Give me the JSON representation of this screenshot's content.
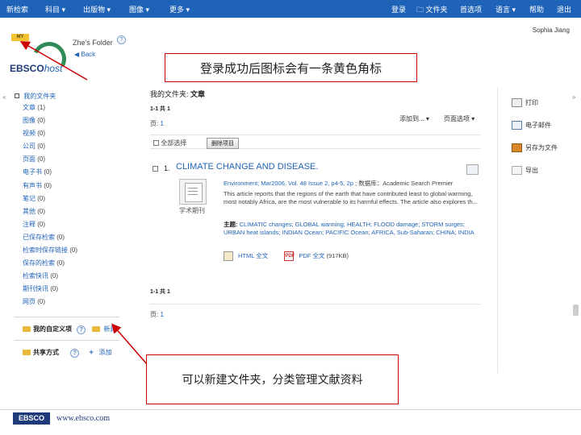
{
  "topnav": {
    "items": [
      "新检索",
      "科目 ▾",
      "出版物 ▾",
      "图像 ▾",
      "更多 ▾",
      "登录",
      "文件夹",
      "首选项",
      "语言 ▾",
      "帮助",
      "退出"
    ]
  },
  "user": {
    "name": "Sophia Jiang"
  },
  "header": {
    "badge": "MY",
    "folder_title": "Zhe's Folder",
    "back": "◀ Back",
    "help": "?",
    "logo_main": "EBSCO",
    "logo_host": "host"
  },
  "callouts": {
    "top": "登录成功后图标会有一条黄色角标",
    "bottom": "可以新建文件夹，分类管理文献资料"
  },
  "sidebar": {
    "collapse_left": "«",
    "collapse_right": "»",
    "heading": "我的文件夹",
    "folders": [
      {
        "label": "文章",
        "count": "(1)"
      },
      {
        "label": "图像",
        "count": "(0)"
      },
      {
        "label": "视频",
        "count": "(0)"
      },
      {
        "label": "公司",
        "count": "(0)"
      },
      {
        "label": "页面",
        "count": "(0)"
      },
      {
        "label": "电子书",
        "count": "(0)"
      },
      {
        "label": "有声书",
        "count": "(0)"
      },
      {
        "label": "笔记",
        "count": "(0)"
      },
      {
        "label": "其他",
        "count": "(0)"
      },
      {
        "label": "注释",
        "count": "(0)"
      },
      {
        "label": "已保存检索",
        "count": "(0)"
      },
      {
        "label": "检索时保存链接",
        "count": "(0)"
      },
      {
        "label": "保存的检索",
        "count": "(0)"
      },
      {
        "label": "检索快讯",
        "count": "(0)"
      },
      {
        "label": "期刊快讯",
        "count": "(0)"
      },
      {
        "label": "网页",
        "count": "(0)"
      }
    ],
    "custom_section": "我的自定义项",
    "custom_new": "新建",
    "shared_section": "共享方式",
    "shared_add": "添加"
  },
  "main": {
    "title_prefix": "我的文件夹:",
    "title_value": "文章",
    "range_top": "1-1 共 1",
    "page_label": "页:",
    "page_num": "1",
    "add_to": "添加到... ▾",
    "page_options": "页面选项 ▾",
    "select_all": "全部选择",
    "delete_items": "删除项目",
    "range_bottom": "1-1 共 1",
    "page_label_bottom": "页:",
    "page_num_bottom": "1"
  },
  "result": {
    "number": "1.",
    "title": "CLIMATE CHANGE AND DISEASE.",
    "meta_source": "Environment; Mar2006, Vol. 48 Issue 2, p4-5, 2p",
    "meta_db": " ; 数据库：Academic Search Premier",
    "doc_label": "学术期刊",
    "abstract": "This article reports that the regions of the earth that have contributed least to global warming, most notably Africa, are the most vulnerable to its harmful effects. The article also explores th...",
    "subjects_label": "主题:",
    "subjects": "CLIMATIC changes; GLOBAL warming; HEALTH; FLOOD damage; STORM surges; URBAN heat islands; INDIAN Ocean; PACIFIC Ocean; AFRICA, Sub-Saharan; CHINA; INDIA",
    "html_label": "HTML 全文",
    "pdf_label": "PDF 全文",
    "pdf_size": "(917KB)"
  },
  "rightpanel": {
    "print": "打印",
    "email": "电子邮件",
    "save": "另存为文件",
    "export": "导出"
  },
  "footer": {
    "logo": "EBSCO",
    "url": "www.ebsco.com"
  }
}
